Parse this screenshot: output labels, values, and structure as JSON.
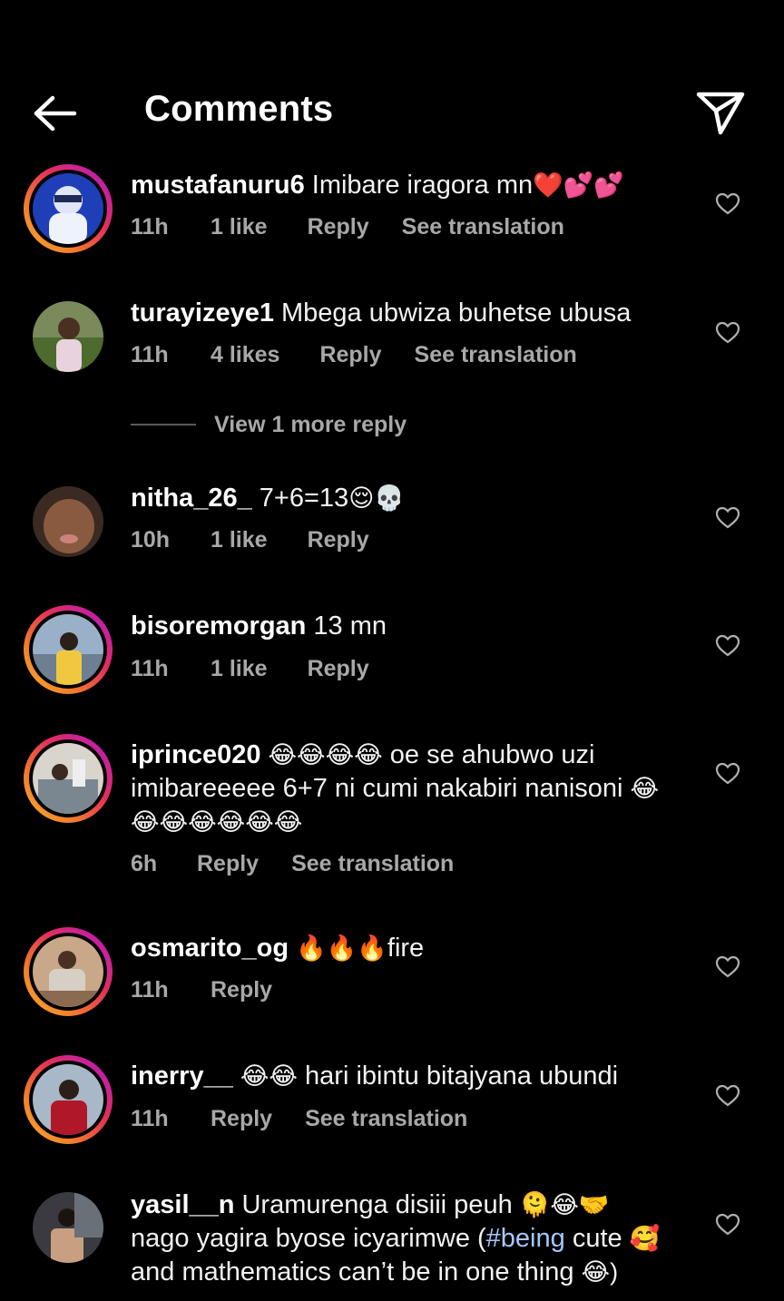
{
  "header": {
    "title": "Comments",
    "back_icon": "arrow-left-icon",
    "share_icon": "paper-plane-icon"
  },
  "comments": [
    {
      "username": "mustafanuru6",
      "text": "Imibare iragora mn",
      "emoji": "❤️💕💕",
      "time": "11h",
      "likes": "1 like",
      "reply": "Reply",
      "translation": "See translation"
    },
    {
      "username": "turayizeye1",
      "text": "Mbega ubwiza buhetse ubusa",
      "time": "11h",
      "likes": "4 likes",
      "reply": "Reply",
      "translation": "See translation"
    },
    {
      "username": "nitha_26_",
      "text": "7+6=13",
      "emoji": "😌💀",
      "time": "10h",
      "likes": "1 like",
      "reply": "Reply"
    },
    {
      "username": "bisoremorgan",
      "text": "13 mn",
      "time": "11h",
      "likes": "1 like",
      "reply": "Reply"
    },
    {
      "username": "iprince020",
      "emoji_lead": "😂😂😂😂",
      "text": "oe se ahubwo uzi imibareeeee 6+7 ni cumi nakabiri nanisoni",
      "emoji_tail": "😂😂😂😂😂😂😂",
      "time": "6h",
      "reply": "Reply",
      "translation": "See translation"
    },
    {
      "username": "osmarito_og",
      "emoji_lead": "🔥🔥🔥",
      "text": "fire",
      "time": "11h",
      "reply": "Reply"
    },
    {
      "username": "inerry__",
      "emoji_lead": "😂😂",
      "text": "hari ibintu bitajyana ubundi",
      "time": "11h",
      "reply": "Reply",
      "translation": "See translation"
    },
    {
      "username": "yasil__n",
      "text_a": "Uramurenga disiii peuh",
      "emoji_a": "🫠😂🤝",
      "text_b": "nago yagira byose icyarimwe (",
      "hashtag": "#being",
      "text_c": "cute",
      "emoji_b": "🥰",
      "text_d": "and mathematics can’t be in one thing",
      "emoji_c": "😂)"
    }
  ],
  "view_more": {
    "label": "View 1 more reply"
  },
  "colors": {
    "background": "#000000",
    "text": "#f5f5f5",
    "meta": "#a8a8a8",
    "story_ring": "#e4305a",
    "hashtag": "#a5c8ff"
  }
}
